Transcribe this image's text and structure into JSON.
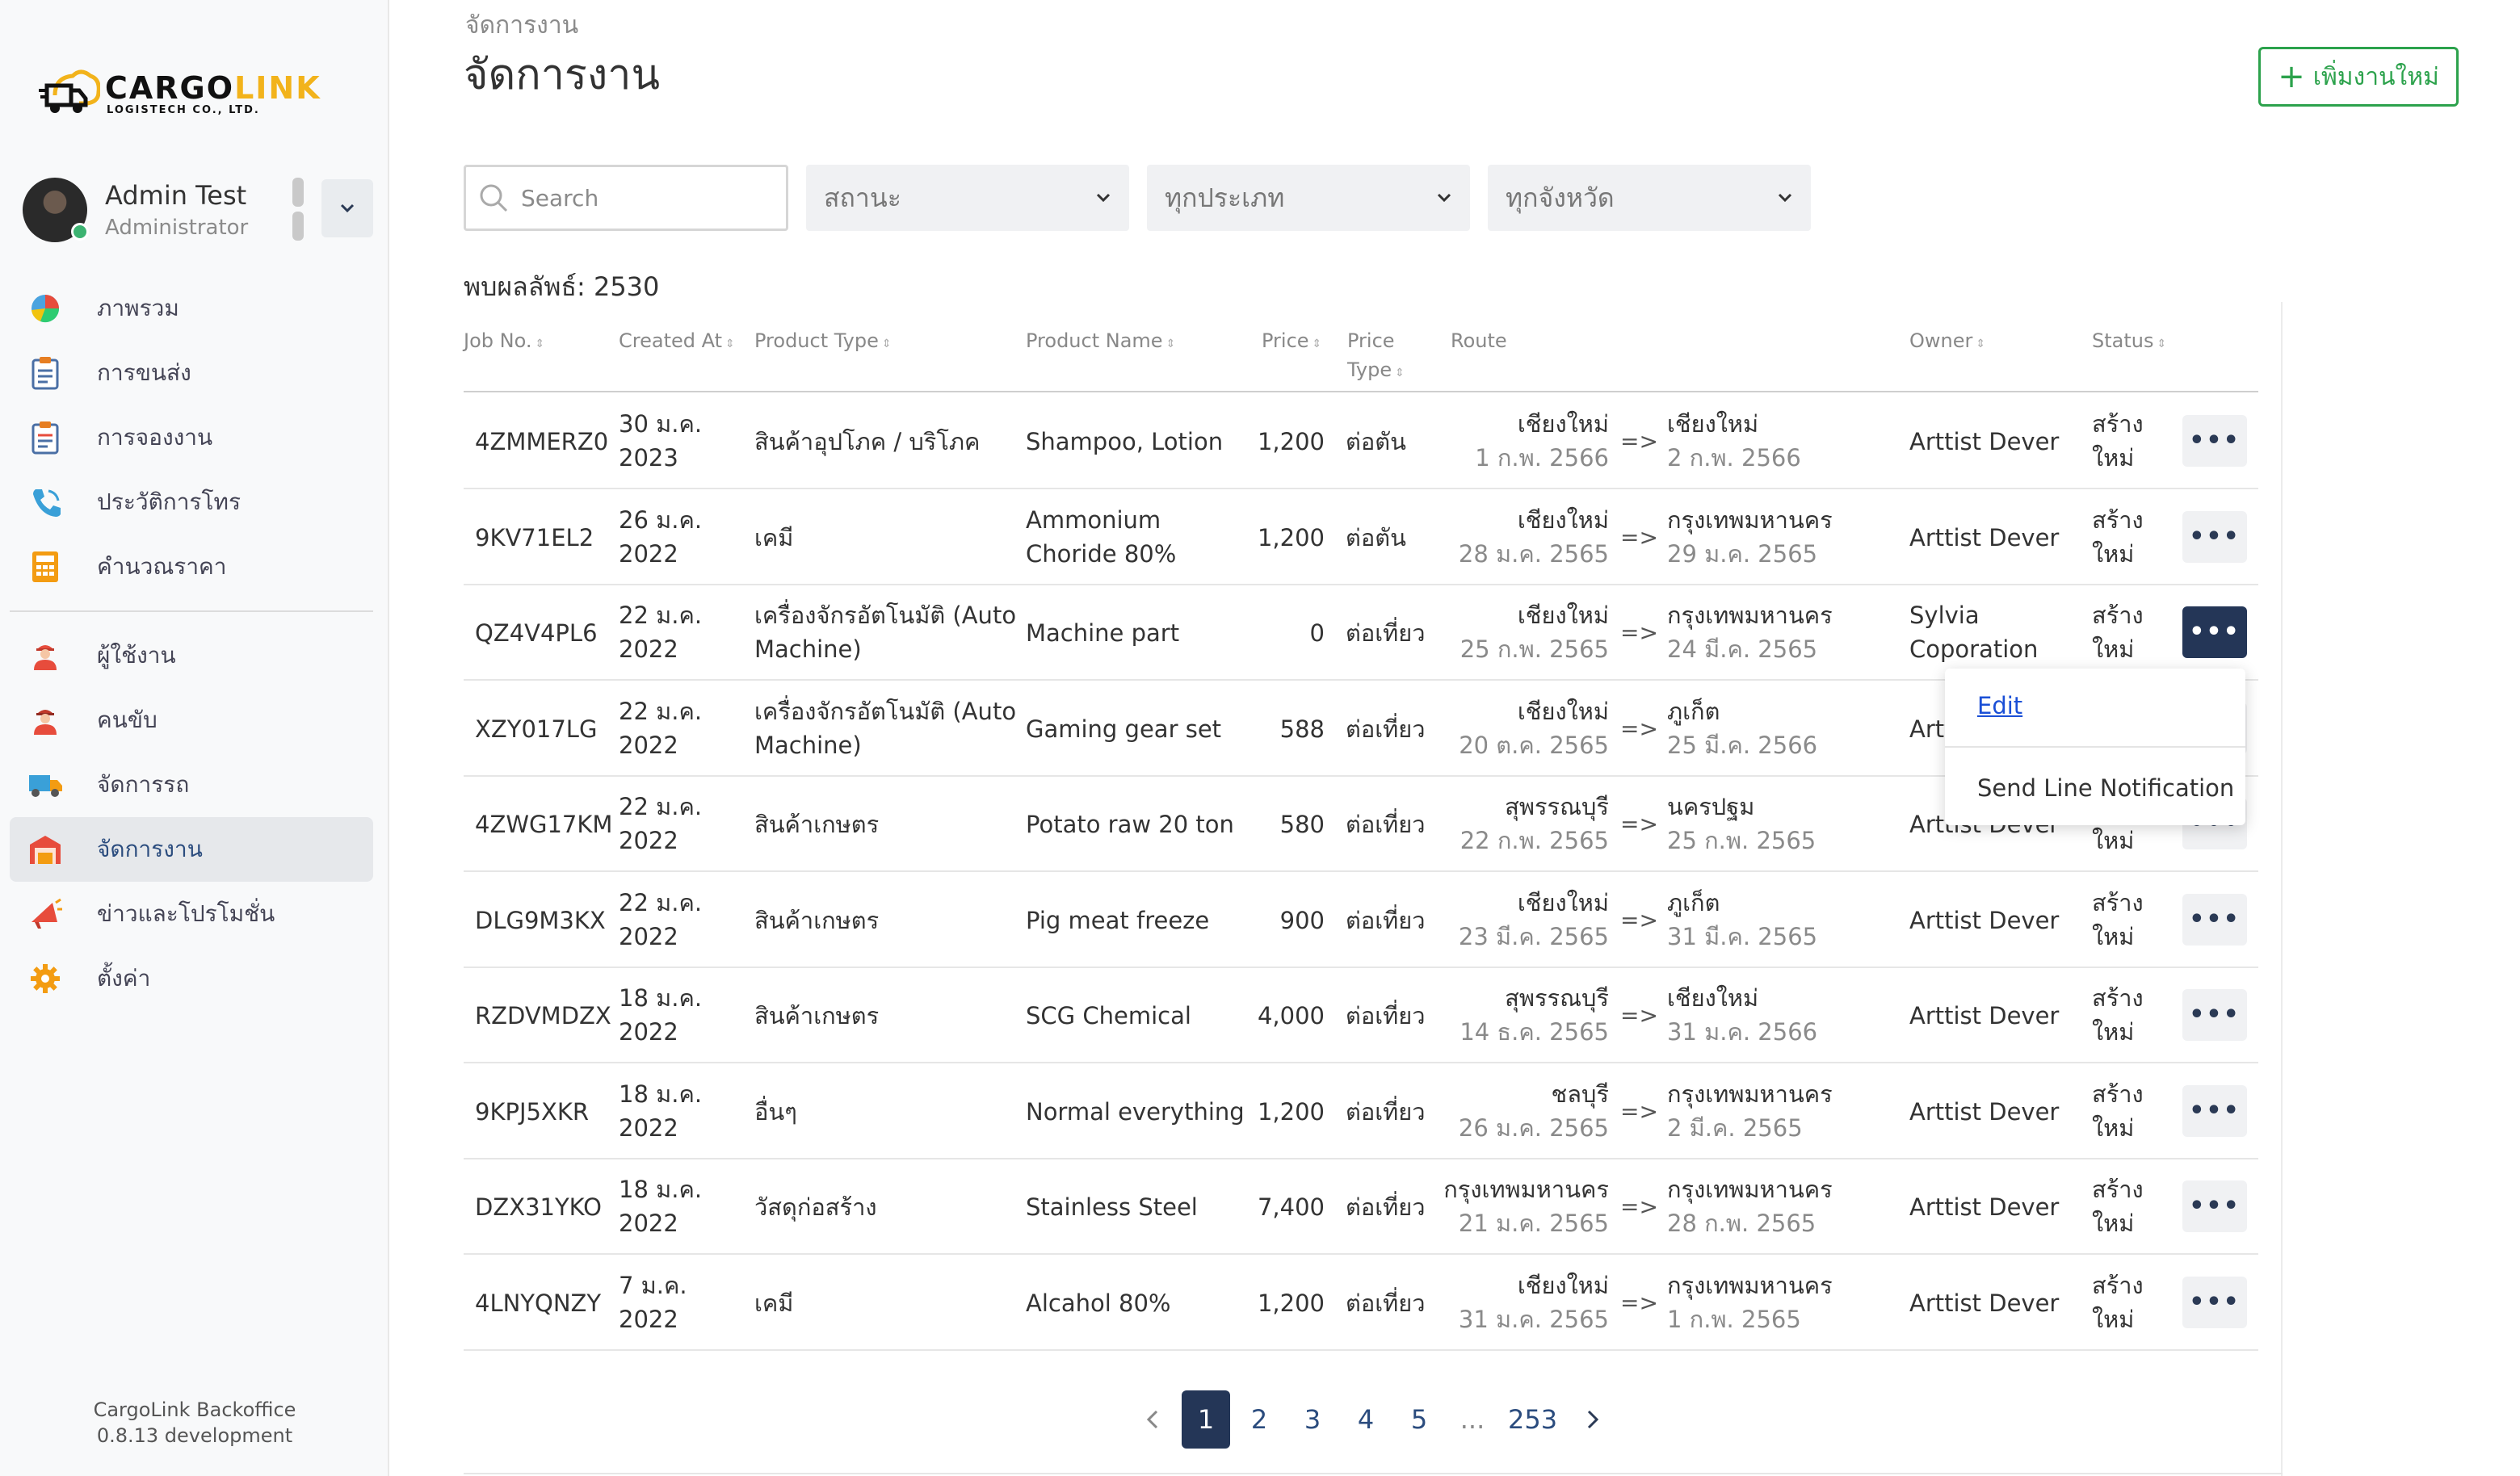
{
  "app": {
    "logo_main_a": "CARGO",
    "logo_main_b": "LINK",
    "logo_sub": "LOGISTECH CO., LTD."
  },
  "profile": {
    "name": "Admin Test",
    "role": "Administrator"
  },
  "sidebar": {
    "items": [
      {
        "label": "ภาพรวม",
        "icon": "pie-chart-icon"
      },
      {
        "label": "การขนส่ง",
        "icon": "clipboard-icon"
      },
      {
        "label": "การจองงาน",
        "icon": "clipboard-list-icon"
      },
      {
        "label": "ประวัติการโทร",
        "icon": "phone-icon"
      },
      {
        "label": "คำนวณราคา",
        "icon": "calculator-icon"
      },
      {
        "label": "ผู้ใช้งาน",
        "icon": "user-worker-icon"
      },
      {
        "label": "คนขับ",
        "icon": "driver-icon"
      },
      {
        "label": "จัดการรถ",
        "icon": "truck-icon"
      },
      {
        "label": "จัดการงาน",
        "icon": "warehouse-icon",
        "active": true
      },
      {
        "label": "ข่าวและโปรโมชั่น",
        "icon": "megaphone-icon"
      },
      {
        "label": "ตั้งค่า",
        "icon": "gear-icon"
      }
    ],
    "footer_line1": "CargoLink Backoffice",
    "footer_line2": "0.8.13 development"
  },
  "header": {
    "breadcrumb": "จัดการงาน",
    "title": "จัดการงาน",
    "add_button": "เพิ่มงานใหม่"
  },
  "filters": {
    "search_placeholder": "Search",
    "status": "สถานะ",
    "type": "ทุกประเภท",
    "province": "ทุกจังหวัด"
  },
  "result_text": "พบผลลัพธ์: 2530",
  "table": {
    "headers": {
      "job_no": "Job No.",
      "created_at": "Created At",
      "product_type": "Product Type",
      "product_name": "Product Name",
      "price": "Price",
      "price_type_1": "Price",
      "price_type_2": "Type",
      "route": "Route",
      "owner": "Owner",
      "status": "Status"
    },
    "rows": [
      {
        "job": "4ZMMERZ0",
        "d1": "30 ม.ค.",
        "d2": "2023",
        "pt1": "สินค้าอุปโภค / บริโภค",
        "pt2": "",
        "pn1": "Shampoo, Lotion",
        "pn2": "",
        "price": "1,200",
        "ptype": "ต่อตัน",
        "from": "เชียงใหม่",
        "from_date": "1 ก.พ. 2566",
        "to": "เชียงใหม่",
        "to_date": "2 ก.พ. 2566",
        "o1": "Arttist Dever",
        "o2": "",
        "s1": "สร้าง",
        "s2": "ใหม่"
      },
      {
        "job": "9KV71EL2",
        "d1": "26 ม.ค.",
        "d2": "2022",
        "pt1": "เคมี",
        "pt2": "",
        "pn1": "Ammonium",
        "pn2": "Choride 80%",
        "price": "1,200",
        "ptype": "ต่อตัน",
        "from": "เชียงใหม่",
        "from_date": "28 ม.ค. 2565",
        "to": "กรุงเทพมหานคร",
        "to_date": "29 ม.ค. 2565",
        "o1": "Arttist Dever",
        "o2": "",
        "s1": "สร้าง",
        "s2": "ใหม่"
      },
      {
        "job": "QZ4V4PL6",
        "d1": "22 ม.ค.",
        "d2": "2022",
        "pt1": "เครื่องจักรอัตโนมัติ (Auto",
        "pt2": "Machine)",
        "pn1": "Machine part",
        "pn2": "",
        "price": "0",
        "ptype": "ต่อเที่ยว",
        "from": "เชียงใหม่",
        "from_date": "25 ก.พ. 2565",
        "to": "กรุงเทพมหานคร",
        "to_date": "24 มี.ค. 2565",
        "o1": "Sylvia",
        "o2": "Coporation",
        "s1": "สร้าง",
        "s2": "ใหม่"
      },
      {
        "job": "XZY017LG",
        "d1": "22 ม.ค.",
        "d2": "2022",
        "pt1": "เครื่องจักรอัตโนมัติ (Auto",
        "pt2": "Machine)",
        "pn1": "Gaming gear set",
        "pn2": "",
        "price": "588",
        "ptype": "ต่อเที่ยว",
        "from": "เชียงใหม่",
        "from_date": "20 ต.ค. 2565",
        "to": "ภูเก็ต",
        "to_date": "25 มี.ค. 2566",
        "o1": "Arttist Dever",
        "o2": "",
        "s1": "สร้าง",
        "s2": "ใหม่"
      },
      {
        "job": "4ZWG17KM",
        "d1": "22 ม.ค.",
        "d2": "2022",
        "pt1": "สินค้าเกษตร",
        "pt2": "",
        "pn1": "Potato raw 20 ton",
        "pn2": "",
        "price": "580",
        "ptype": "ต่อเที่ยว",
        "from": "สุพรรณบุรี",
        "from_date": "22 ก.พ. 2565",
        "to": "นครปฐม",
        "to_date": "25 ก.พ. 2565",
        "o1": "Arttist Dever",
        "o2": "",
        "s1": "สร้าง",
        "s2": "ใหม่"
      },
      {
        "job": "DLG9M3KX",
        "d1": "22 ม.ค.",
        "d2": "2022",
        "pt1": "สินค้าเกษตร",
        "pt2": "",
        "pn1": "Pig meat freeze",
        "pn2": "",
        "price": "900",
        "ptype": "ต่อเที่ยว",
        "from": "เชียงใหม่",
        "from_date": "23 มี.ค. 2565",
        "to": "ภูเก็ต",
        "to_date": "31 มี.ค. 2565",
        "o1": "Arttist Dever",
        "o2": "",
        "s1": "สร้าง",
        "s2": "ใหม่"
      },
      {
        "job": "RZDVMDZX",
        "d1": "18 ม.ค.",
        "d2": "2022",
        "pt1": "สินค้าเกษตร",
        "pt2": "",
        "pn1": "SCG Chemical",
        "pn2": "",
        "price": "4,000",
        "ptype": "ต่อเที่ยว",
        "from": "สุพรรณบุรี",
        "from_date": "14 ธ.ค. 2565",
        "to": "เชียงใหม่",
        "to_date": "31 ม.ค. 2566",
        "o1": "Arttist Dever",
        "o2": "",
        "s1": "สร้าง",
        "s2": "ใหม่"
      },
      {
        "job": "9KPJ5XKR",
        "d1": "18 ม.ค.",
        "d2": "2022",
        "pt1": "อื่นๆ",
        "pt2": "",
        "pn1": "Normal everything",
        "pn2": "",
        "price": "1,200",
        "ptype": "ต่อเที่ยว",
        "from": "ชลบุรี",
        "from_date": "26 ม.ค. 2565",
        "to": "กรุงเทพมหานคร",
        "to_date": "2 มี.ค. 2565",
        "o1": "Arttist Dever",
        "o2": "",
        "s1": "สร้าง",
        "s2": "ใหม่"
      },
      {
        "job": "DZX31YKO",
        "d1": "18 ม.ค.",
        "d2": "2022",
        "pt1": "วัสดุก่อสร้าง",
        "pt2": "",
        "pn1": "Stainless Steel",
        "pn2": "",
        "price": "7,400",
        "ptype": "ต่อเที่ยว",
        "from": "กรุงเทพมหานคร",
        "from_date": "21 ม.ค. 2565",
        "to": "กรุงเทพมหานคร",
        "to_date": "28 ก.พ. 2565",
        "o1": "Arttist Dever",
        "o2": "",
        "s1": "สร้าง",
        "s2": "ใหม่"
      },
      {
        "job": "4LNYQNZY",
        "d1": "7 ม.ค.",
        "d2": "2022",
        "pt1": "เคมี",
        "pt2": "",
        "pn1": "Alcahol 80%",
        "pn2": "",
        "price": "1,200",
        "ptype": "ต่อเที่ยว",
        "from": "เชียงใหม่",
        "from_date": "31 ม.ค. 2565",
        "to": "กรุงเทพมหานคร",
        "to_date": "1 ก.พ. 2565",
        "o1": "Arttist Dever",
        "o2": "",
        "s1": "สร้าง",
        "s2": "ใหม่"
      }
    ],
    "route_arrow": "=>"
  },
  "row_menu": {
    "edit": "Edit",
    "notify": "Send Line Notification"
  },
  "pagination": {
    "pages": [
      "1",
      "2",
      "3",
      "4",
      "5"
    ],
    "ellipsis": "...",
    "last": "253",
    "current": "1"
  },
  "colors": {
    "accent": "#2ca24c",
    "primary_dark": "#243657",
    "logo_yellow": "#f2b31b"
  }
}
